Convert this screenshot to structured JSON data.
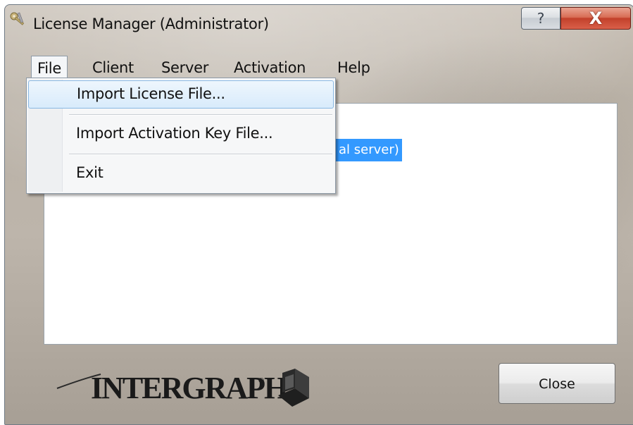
{
  "window": {
    "title": "License Manager (Administrator)",
    "help_glyph": "?",
    "close_glyph": "X"
  },
  "menubar": {
    "items": [
      {
        "label": "File",
        "open": true
      },
      {
        "label": "Client"
      },
      {
        "label": "Server"
      },
      {
        "label": "Activation"
      },
      {
        "label": "Help"
      }
    ]
  },
  "file_menu": {
    "items": [
      {
        "label": "Import License File...",
        "highlighted": true
      },
      {
        "label": "Import Activation Key File..."
      },
      {
        "label": "Exit"
      }
    ]
  },
  "content": {
    "selected_text": "al server)"
  },
  "logo": {
    "wordmark": "INTERGRAPH",
    "trademark": "®"
  },
  "buttons": {
    "close_label": "Close"
  },
  "colors": {
    "selection_blue": "#3399ff",
    "menu_highlight_border": "#89b8e3",
    "close_caption_red": "#c2402a"
  },
  "icons": {
    "app": "keys-icon",
    "help": "help-icon",
    "close": "close-icon",
    "logo_mark": "intergraph-logo-icon"
  }
}
